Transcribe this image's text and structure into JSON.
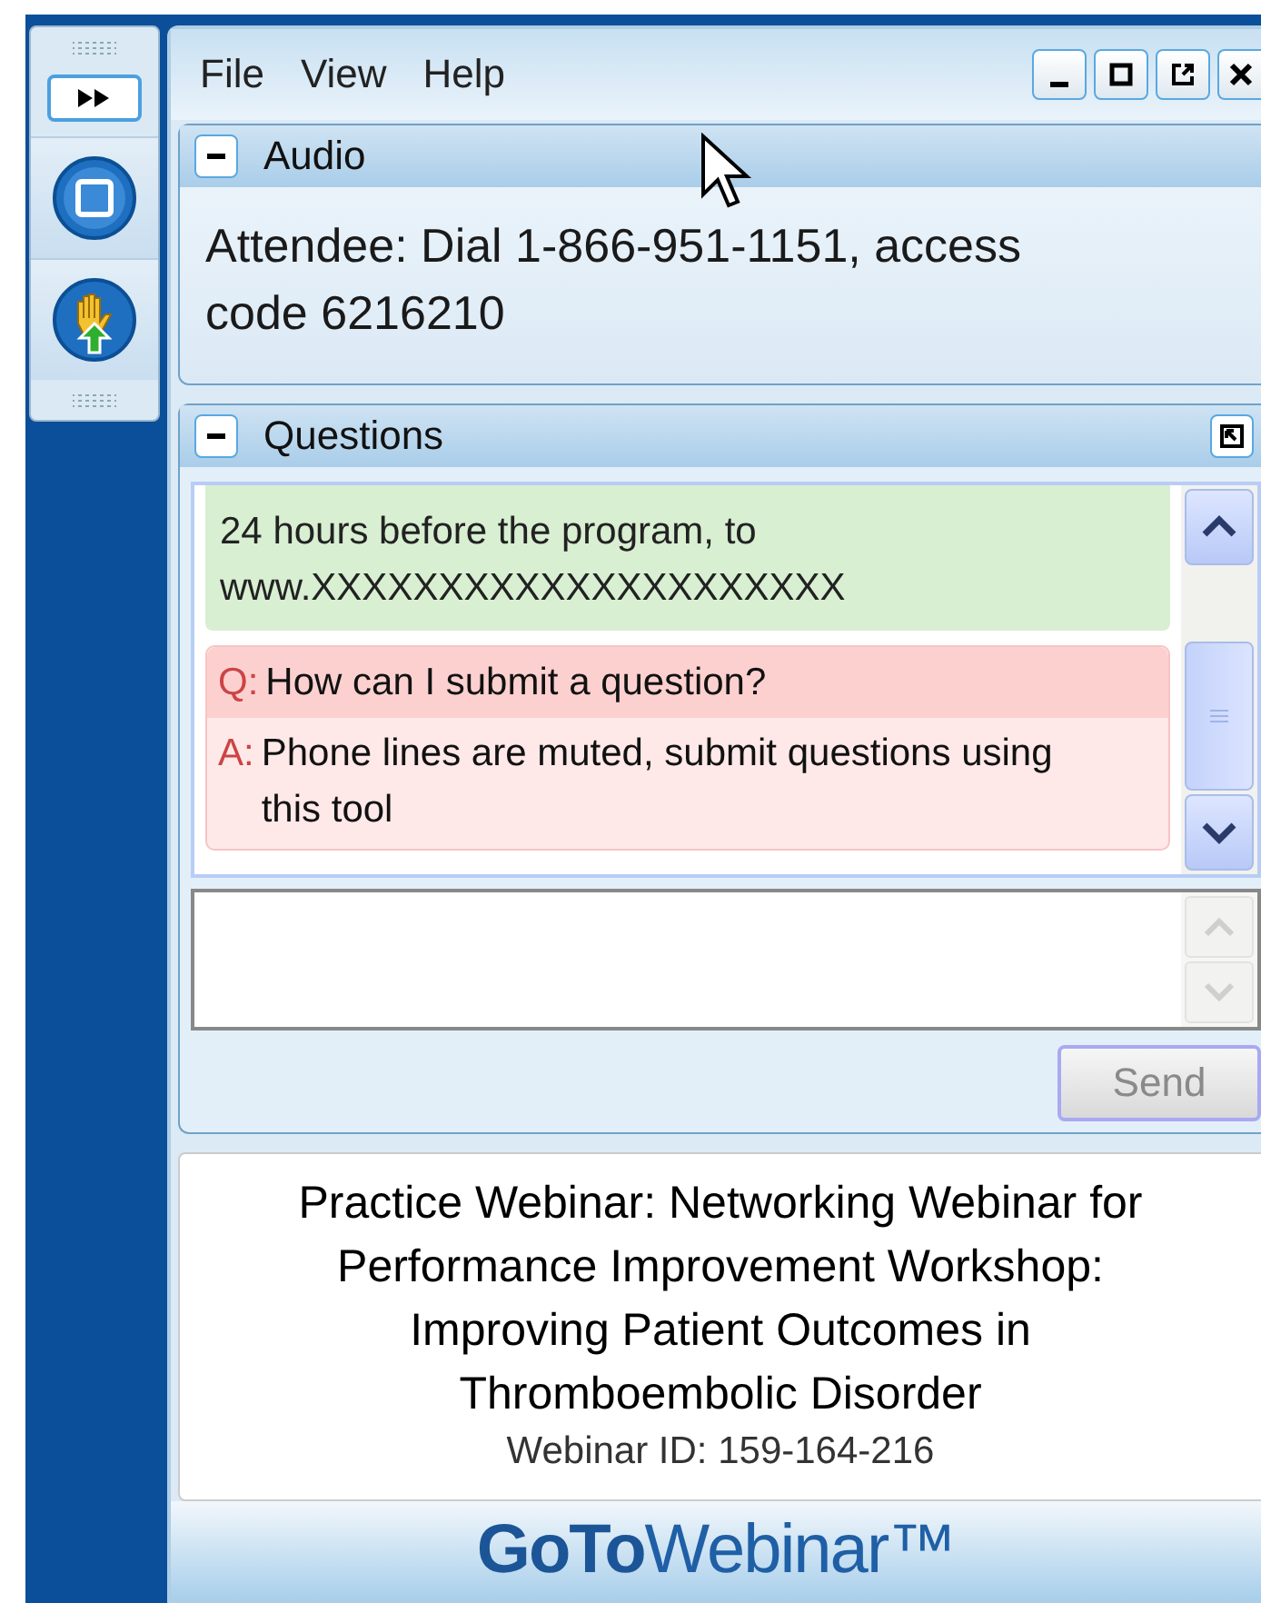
{
  "menu": [
    {
      "label": "File"
    },
    {
      "label": "View"
    },
    {
      "label": "Help"
    }
  ],
  "audio": {
    "title": "Audio",
    "expanded": true,
    "text": "Attendee: Dial 1-866-951-1151, access code 6216210"
  },
  "questions": {
    "title": "Questions",
    "expanded": true,
    "messages": [
      {
        "kind": "note",
        "text": "24 hours before the program, to www.XXXXXXXXXXXXXXXXXXXXX"
      },
      {
        "kind": "qa",
        "q_label": "Q:",
        "question": "How can I submit a question?",
        "a_label": "A:",
        "answer": "Phone lines are muted, submit questions using this tool"
      }
    ],
    "send": {
      "label": "Send",
      "disabled": true
    }
  },
  "info": {
    "title": "Practice Webinar: Networking Webinar for Performance Improvement Workshop: Improving Patient Outcomes in Thromboembolic Disorder",
    "webinar_id": "Webinar ID: 159-164-216"
  },
  "logo": "**GoTo**Webinar™"
}
